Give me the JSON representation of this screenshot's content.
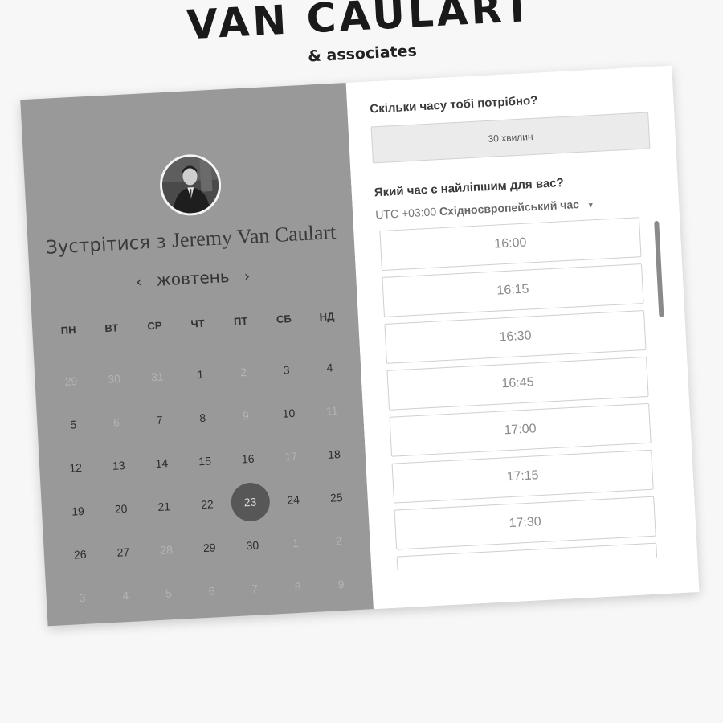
{
  "brand": {
    "name": "VAN CAULART",
    "tagline": "& associates"
  },
  "meeting": {
    "prefix": "Зустрітися з",
    "person": "Jeremy Van Caulart"
  },
  "calendar": {
    "month": "жовтень",
    "prev_arrow": "‹",
    "next_arrow": "›",
    "weekdays": [
      "ПН",
      "ВТ",
      "СР",
      "ЧТ",
      "ПТ",
      "СБ",
      "НД"
    ],
    "days": [
      {
        "label": "29",
        "muted": true
      },
      {
        "label": "30",
        "muted": true
      },
      {
        "label": "31",
        "muted": true
      },
      {
        "label": "1",
        "muted": false
      },
      {
        "label": "2",
        "muted": true
      },
      {
        "label": "3",
        "muted": false
      },
      {
        "label": "4",
        "muted": false
      },
      {
        "label": "5",
        "muted": false
      },
      {
        "label": "6",
        "muted": true
      },
      {
        "label": "7",
        "muted": false
      },
      {
        "label": "8",
        "muted": false
      },
      {
        "label": "9",
        "muted": true
      },
      {
        "label": "10",
        "muted": false
      },
      {
        "label": "11",
        "muted": true
      },
      {
        "label": "12",
        "muted": false
      },
      {
        "label": "13",
        "muted": false
      },
      {
        "label": "14",
        "muted": false
      },
      {
        "label": "15",
        "muted": false
      },
      {
        "label": "16",
        "muted": false
      },
      {
        "label": "17",
        "muted": true
      },
      {
        "label": "18",
        "muted": false
      },
      {
        "label": "19",
        "muted": false
      },
      {
        "label": "20",
        "muted": false
      },
      {
        "label": "21",
        "muted": false
      },
      {
        "label": "22",
        "muted": false
      },
      {
        "label": "23",
        "muted": false,
        "selected": true
      },
      {
        "label": "24",
        "muted": false
      },
      {
        "label": "25",
        "muted": false
      },
      {
        "label": "26",
        "muted": false
      },
      {
        "label": "27",
        "muted": false
      },
      {
        "label": "28",
        "muted": true
      },
      {
        "label": "29",
        "muted": false
      },
      {
        "label": "30",
        "muted": false
      },
      {
        "label": "1",
        "muted": true
      },
      {
        "label": "2",
        "muted": true
      },
      {
        "label": "3",
        "muted": true
      },
      {
        "label": "4",
        "muted": true
      },
      {
        "label": "5",
        "muted": true
      },
      {
        "label": "6",
        "muted": true
      },
      {
        "label": "7",
        "muted": true
      },
      {
        "label": "8",
        "muted": true
      },
      {
        "label": "9",
        "muted": true
      }
    ]
  },
  "booking": {
    "duration_question": "Скільки часу тобі потрібно?",
    "duration_value": "30 хвилин",
    "time_question": "Який час є найліпшим для вас?",
    "timezone_offset": "UTC +03:00",
    "timezone_name": "Східноєвропейський час",
    "slots": [
      "16:00",
      "16:15",
      "16:30",
      "16:45",
      "17:00",
      "17:15",
      "17:30",
      ""
    ]
  },
  "colors": {
    "left_panel": "#999999",
    "selected_day": "#575757",
    "page_bg": "#f7f7f7"
  },
  "icons": {
    "prev_month": "chevron-left-icon",
    "next_month": "chevron-right-icon",
    "timezone_dropdown": "caret-down-icon"
  }
}
